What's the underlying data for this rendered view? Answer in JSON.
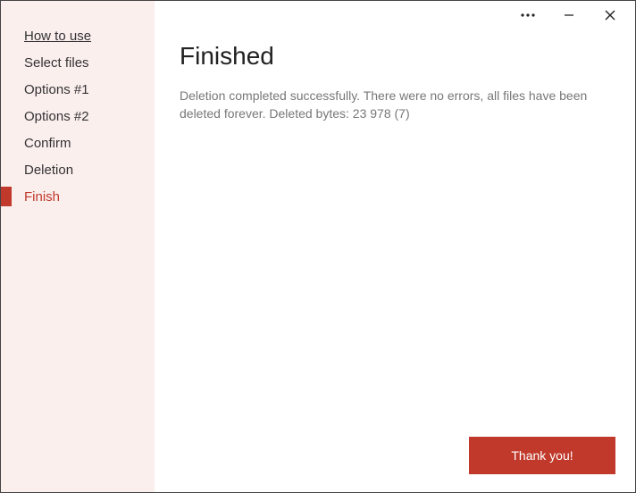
{
  "sidebar": {
    "items": [
      {
        "label": "How to use",
        "link": true,
        "active": false
      },
      {
        "label": "Select files",
        "link": false,
        "active": false
      },
      {
        "label": "Options #1",
        "link": false,
        "active": false
      },
      {
        "label": "Options #2",
        "link": false,
        "active": false
      },
      {
        "label": "Confirm",
        "link": false,
        "active": false
      },
      {
        "label": "Deletion",
        "link": false,
        "active": false
      },
      {
        "label": "Finish",
        "link": false,
        "active": true
      }
    ]
  },
  "main": {
    "heading": "Finished",
    "body": "Deletion completed successfully. There were no errors, all files have been deleted forever. Deleted bytes: 23 978 (7)"
  },
  "footer": {
    "primary_label": "Thank you!"
  },
  "colors": {
    "accent": "#c0392b",
    "sidebar_bg": "#fbefee"
  }
}
